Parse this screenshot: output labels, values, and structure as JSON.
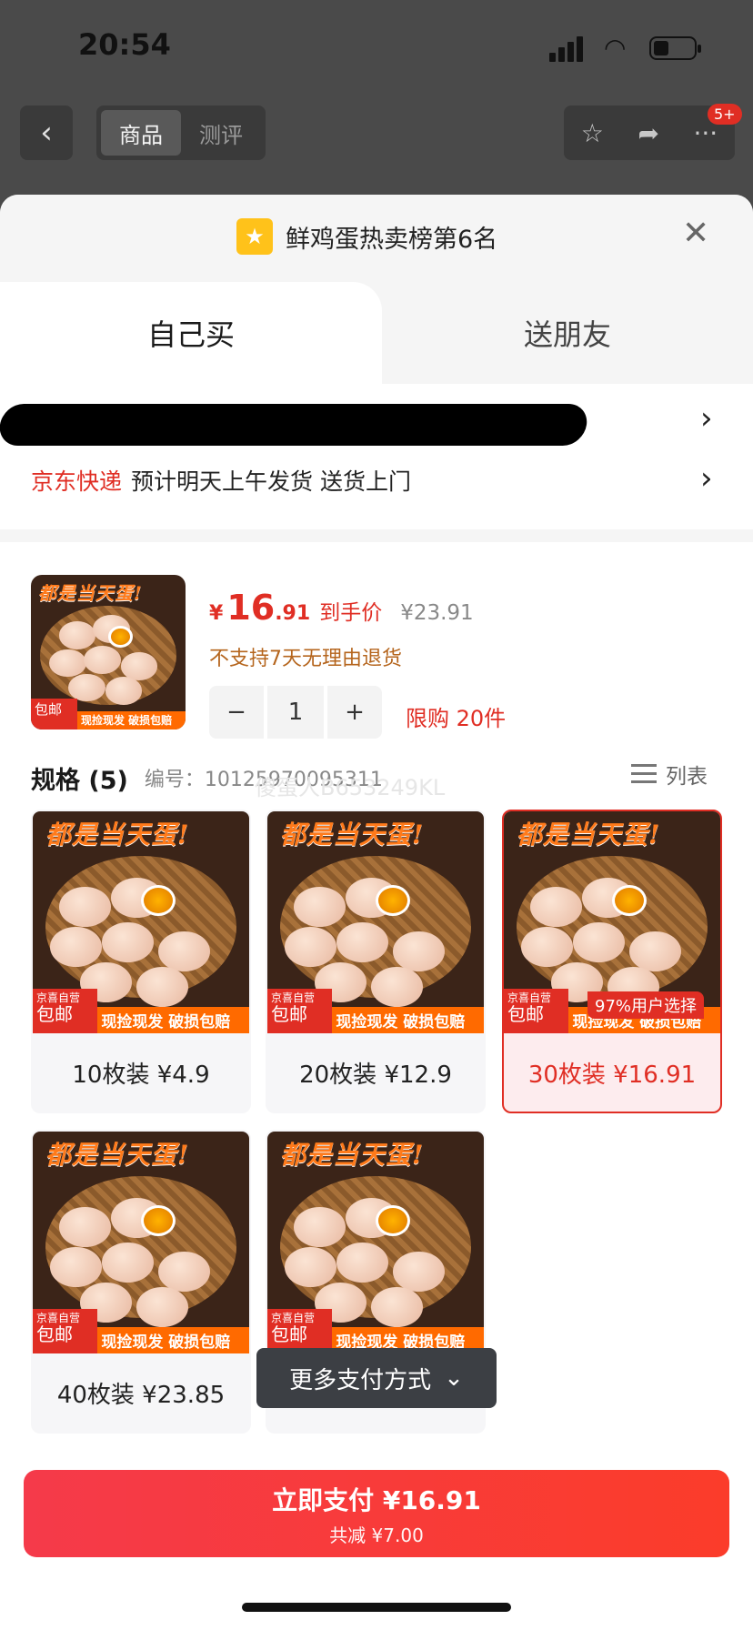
{
  "status": {
    "time": "20:54"
  },
  "nav": {
    "tab_goods": "商品",
    "tab_review": "测评",
    "badge": "5+"
  },
  "sheet": {
    "rank_text": "鲜鸡蛋热卖榜第6名",
    "tab_self": "自己买",
    "tab_gift": "送朋友",
    "delivery_brand": "京东快递",
    "delivery_text": "预计明天上午发货 送货上门"
  },
  "product": {
    "yen": "¥",
    "price_int": "16",
    "price_dec": ".91",
    "price_tag": "到手价",
    "orig_price": "¥23.91",
    "no_return": "不支持7天无理由退货",
    "qty": "1",
    "limit": "限购 20件"
  },
  "spec": {
    "title": "规格 (5)",
    "code": "编号：10125970095311",
    "watermark": "傻蛋人B653249KL",
    "list_label": "列表",
    "popular_tag": "97%用户选择"
  },
  "egg_image": {
    "title": "都是当天蛋!",
    "free_small": "京喜自营",
    "free_big": "包邮",
    "strip": "现捡现发 破损包赔"
  },
  "skus": [
    {
      "label": "10枚装 ¥4.9"
    },
    {
      "label": "20枚装 ¥12.9"
    },
    {
      "label": "30枚装 ¥16.91"
    },
    {
      "label": "40枚装 ¥23.85"
    },
    {
      "label": ""
    }
  ],
  "more_pay": "更多支付方式",
  "pay": {
    "main": "立即支付 ¥16.91",
    "sub": "共减 ¥7.00"
  },
  "colors": {
    "accent": "#e02e24",
    "pay": "#f53a4a"
  }
}
